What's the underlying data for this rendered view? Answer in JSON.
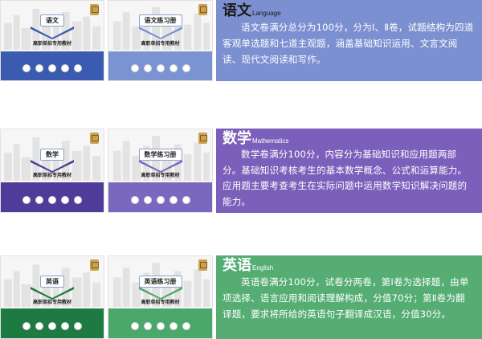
{
  "colors": {
    "chinese_dark": "#3a5bb0",
    "chinese_light": "#7b93d1",
    "chinese_panel": "#7c8fd0",
    "math_dark": "#4e3b9a",
    "math_light": "#7a68c0",
    "math_panel": "#7b5fba",
    "english_dark": "#1e7a43",
    "english_light": "#4aa86a",
    "english_panel": "#55ad73"
  },
  "book_common": {
    "subtitle": "高职单招专用教材"
  },
  "sections": {
    "chinese": {
      "book1_title": "语文",
      "book2_title": "语文练习册",
      "panel_title_cn": "语文",
      "panel_title_en": "Language",
      "panel_body": "语文卷满分总分为100分，分为Ⅰ、Ⅱ卷，试题结构为四道客观单选题和七道主观题，涵盖基础知识运用、文言文阅读、现代文阅读和写作。"
    },
    "math": {
      "book1_title": "数学",
      "book2_title": "数学练习册",
      "panel_title_cn": "数学",
      "panel_title_en": "Mathematics",
      "panel_body": "数学卷满分100分，内容分为基础知识和应用题两部分。基础知识考核考生的基本数学概念、公式和运算能力。应用题主要考查考生在实际问题中运用数学知识解决问题的能力。"
    },
    "english": {
      "book1_title": "英语",
      "book2_title": "英语练习册",
      "panel_title_cn": "英语",
      "panel_title_en": "English",
      "panel_body": "英语卷满分100分，试卷分两卷，第Ⅰ卷为选择题，由单项选择、语言应用和阅读理解构成，分值70分；第Ⅱ卷为翻译题，要求将所给的英语句子翻译成汉语，分值30分。"
    }
  }
}
